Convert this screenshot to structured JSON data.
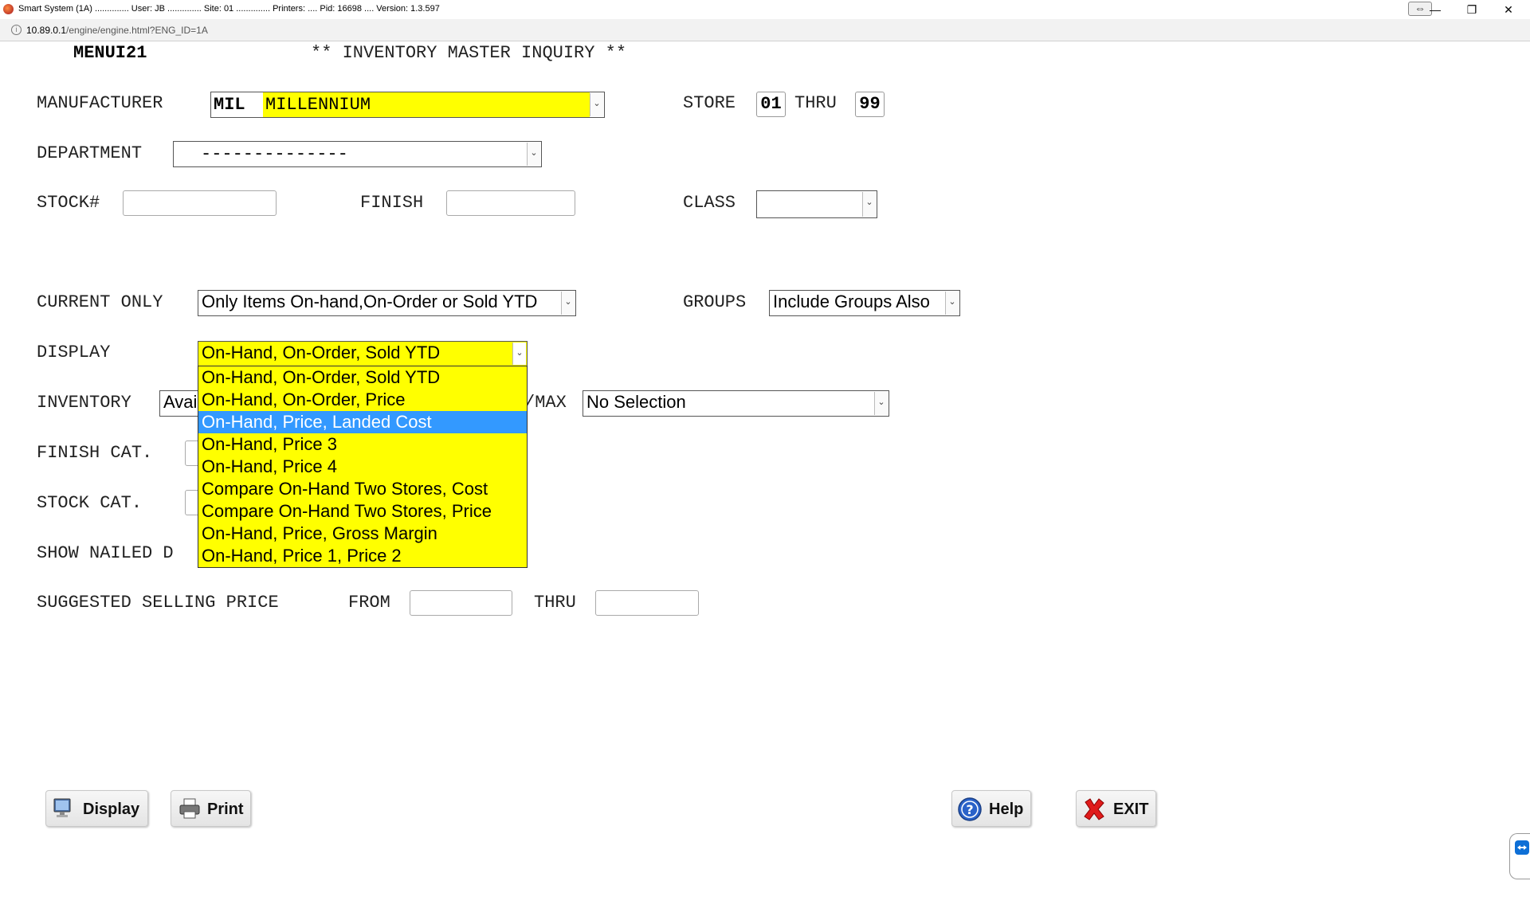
{
  "window": {
    "title": "Smart System (1A) .............. User: JB .............. Site: 01 .............. Printers: .... Pid: 16698 .... Version: 1.3.597",
    "minimize_glyph": "—",
    "maximize_glyph": "❐",
    "close_glyph": "✕",
    "restore_glyph": "⇔"
  },
  "address": {
    "host": "10.89.0.1",
    "path": "/engine/engine.html?ENG_ID=1A",
    "info_glyph": "i"
  },
  "header": {
    "menu_id": "MENUI21",
    "title": "** INVENTORY MASTER INQUIRY **"
  },
  "manufacturer": {
    "label": "MANUFACTURER",
    "code": "MIL",
    "name": "MILLENNIUM"
  },
  "store": {
    "label": "STORE",
    "from": "01",
    "thru_label": "THRU",
    "to": "99"
  },
  "department": {
    "label": "DEPARTMENT",
    "value": "--------------"
  },
  "stock": {
    "label": "STOCK#",
    "value": ""
  },
  "finish": {
    "label": "FINISH",
    "value": ""
  },
  "class_field": {
    "label": "CLASS",
    "value": ""
  },
  "current_only": {
    "label": "CURRENT ONLY",
    "value": "Only Items On-hand,On-Order or Sold YTD"
  },
  "groups": {
    "label": "GROUPS",
    "value": "Include Groups Also"
  },
  "display": {
    "label": "DISPLAY",
    "value": "On-Hand, On-Order, Sold YTD",
    "options": [
      "On-Hand, On-Order, Sold YTD",
      "On-Hand, On-Order, Price",
      "On-Hand, Price, Landed Cost",
      "On-Hand, Price 3",
      "On-Hand, Price 4",
      "Compare On-Hand Two Stores, Cost",
      "Compare On-Hand Two Stores, Price",
      "On-Hand, Price, Gross Margin",
      "On-Hand, Price 1, Price 2"
    ],
    "highlighted_index": 2
  },
  "inventory": {
    "label": "INVENTORY",
    "value_partial": "Avai"
  },
  "minmax": {
    "label_partial": "/MAX",
    "value": "No Selection"
  },
  "finish_cat": {
    "label": "FINISH CAT."
  },
  "stock_cat": {
    "label": "STOCK CAT."
  },
  "show_nailed": {
    "label_partial": "SHOW NAILED D"
  },
  "price_range": {
    "label": "SUGGESTED SELLING PRICE",
    "from_label": "FROM",
    "thru_label": "THRU",
    "from_value": "",
    "thru_value": ""
  },
  "buttons": {
    "display": "Display",
    "print": "Print",
    "help": "Help",
    "exit": "EXIT"
  },
  "colors": {
    "highlight_yellow": "#ffff00",
    "selection_blue": "#3399ff"
  },
  "icons": {
    "display_icon": "monitor-icon",
    "print_icon": "printer-icon",
    "help_icon": "question-icon",
    "exit_icon": "red-x-icon",
    "remote_icon": "teamviewer-icon"
  }
}
